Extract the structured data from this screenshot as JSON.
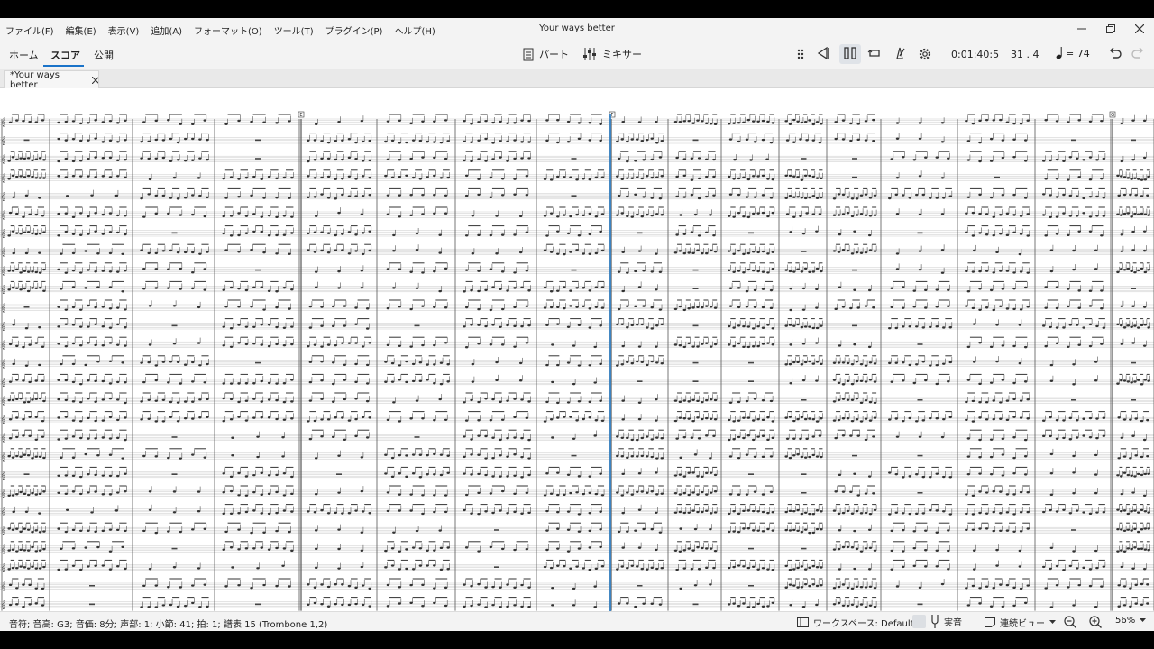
{
  "window": {
    "title": "Your ways better",
    "menu": [
      "ファイル(F)",
      "編集(E)",
      "表示(V)",
      "追加(A)",
      "フォーマット(O)",
      "ツール(T)",
      "プラグイン(P)",
      "ヘルプ(H)"
    ]
  },
  "toolbar": {
    "tabs": [
      "ホーム",
      "スコア",
      "公開"
    ],
    "active_tab": "スコア",
    "parts_label": "パート",
    "mixer_label": "ミキサー",
    "time": "0:01:40:5",
    "position": "31 . 4",
    "tempo": "= 74"
  },
  "document": {
    "tab_label": "*Your ways better"
  },
  "score": {
    "rehearsal_marks": [
      "E",
      "F",
      "G"
    ]
  },
  "statusbar": {
    "info": "音符; 音高: G3; 音価: 8分; 声部: 1; 小節: 41; 拍: 1; 譜表 15 (Trombone 1,2)",
    "workspace": "ワークスペース: Default",
    "concert_pitch": "実音",
    "view_mode": "連続ビュー",
    "zoom": "56%"
  },
  "colors": {
    "accent": "#1a73c9",
    "playback_cursor": "#2f7fc4",
    "background": "#f3f3f3"
  }
}
